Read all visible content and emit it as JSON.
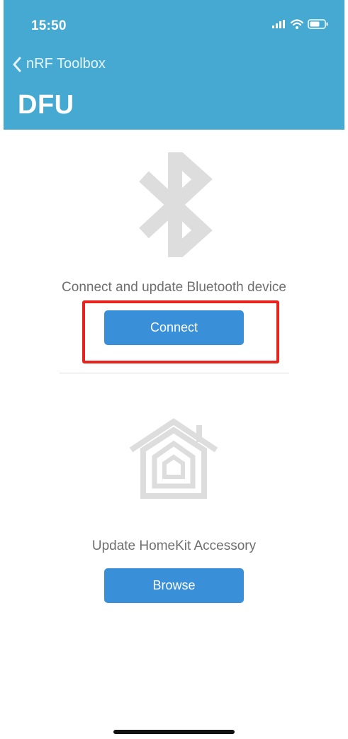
{
  "status_bar": {
    "time": "15:50",
    "icons": [
      "signal-icon",
      "wifi-icon",
      "battery-icon"
    ]
  },
  "nav": {
    "back_label": "nRF Toolbox",
    "title": "DFU"
  },
  "bluetooth_section": {
    "icon": "bluetooth-icon",
    "caption": "Connect and update Bluetooth device",
    "button_label": "Connect"
  },
  "homekit_section": {
    "icon": "homekit-icon",
    "caption": "Update HomeKit Accessory",
    "button_label": "Browse"
  },
  "colors": {
    "header": "#45a9d2",
    "button": "#3a8fd9",
    "highlight": "#e8231d",
    "icon_gray": "#dddddd"
  }
}
